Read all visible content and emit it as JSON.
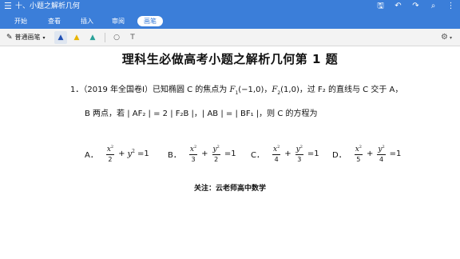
{
  "titlebar": {
    "menu_icon": "☰",
    "title": "十、小题之解析几何",
    "icons": [
      "save-icon",
      "undo-icon",
      "redo-icon",
      "search-icon",
      "more-icon"
    ],
    "icon_glyphs": [
      "🖫",
      "↶",
      "↷",
      "⌕",
      "⋮"
    ]
  },
  "tabs": [
    {
      "label": "开始",
      "active": false
    },
    {
      "label": "查看",
      "active": false
    },
    {
      "label": "插入",
      "active": false
    },
    {
      "label": "审阅",
      "active": false
    },
    {
      "label": "画笔",
      "active": true
    }
  ],
  "toolbar": {
    "pen_label": "普通画笔",
    "pen_icon": "✎",
    "caret": "▾",
    "tool_glyphs": [
      "▲",
      "▲",
      "▲",
      "○",
      "T"
    ],
    "settings_icon": "⚙",
    "settings_caret": "▾"
  },
  "document": {
    "heading": "理科生必做高考小题之解析几何第 1 题",
    "question": {
      "number": "1．",
      "line1_prefix": "（2019 年全国卷Ⅰ）已知椭圆 C 的焦点为 ",
      "f1_text": "F",
      "f1_sub": "1",
      "f1_coord": "(−1,0)",
      "comma": "，",
      "f2_text": "F",
      "f2_sub": "2",
      "f2_coord": "(1,0)",
      "line1_suffix": "，过 F₂ 的直线与 C 交于 A，",
      "line2": "B 两点，若 | AF₂ | = 2 | F₂B |，| AB | = | BF₁ |，则 C 的方程为"
    },
    "options": [
      {
        "letter": "A．",
        "num": "x",
        "den": "2",
        "second": "y",
        "second_den": "",
        "rhs": "=1"
      },
      {
        "letter": "B．",
        "num": "x",
        "den": "3",
        "second": "y",
        "second_den": "2",
        "rhs": "=1"
      },
      {
        "letter": "C．",
        "num": "x",
        "den": "4",
        "second": "y",
        "second_den": "3",
        "rhs": "=1"
      },
      {
        "letter": "D．",
        "num": "x",
        "den": "5",
        "second": "y",
        "second_den": "4",
        "rhs": "=1"
      }
    ],
    "footer": "关注：云老师高中数学"
  },
  "colors": {
    "ribbon": "#3b7ed9",
    "pen_blue": "#1f4fb3",
    "pen_yellow": "#e8b400",
    "pen_teal": "#2aa198"
  }
}
